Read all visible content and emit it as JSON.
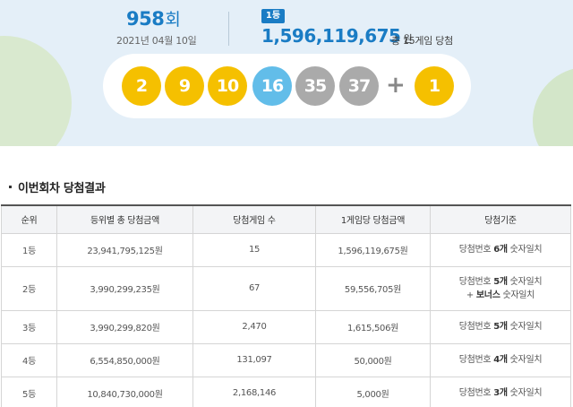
{
  "draw": {
    "round_number": "958",
    "round_unit": "회",
    "date": "2021년 04월 10일",
    "rank_badge": "1등",
    "first_prize": "1,596,119,675",
    "won": "원",
    "winner_summary": "총 15게임 당첨"
  },
  "balls": [
    {
      "number": "2",
      "color": "#f5c000"
    },
    {
      "number": "9",
      "color": "#f5c000"
    },
    {
      "number": "10",
      "color": "#f5c000"
    },
    {
      "number": "16",
      "color": "#62bde9"
    },
    {
      "number": "35",
      "color": "#aaaaaa"
    },
    {
      "number": "37",
      "color": "#aaaaaa"
    }
  ],
  "plus_sign": "+",
  "bonus_ball": {
    "number": "1",
    "color": "#f5c000"
  },
  "section_title": "이번회차 당첨결과",
  "table": {
    "headers": [
      "순위",
      "등위별 총 당첨금액",
      "당첨게임 수",
      "1게임당 당첨금액",
      "당첨기준"
    ],
    "rows": [
      {
        "rank": "1등",
        "total": "23,941,795,125원",
        "games": "15",
        "per_game": "1,596,119,675원",
        "crit_pre": "당첨번호 ",
        "crit_count": "6개",
        "crit_post": " 숫자일치",
        "bonus_pre": "",
        "bonus_bold": "",
        "bonus_post": ""
      },
      {
        "rank": "2등",
        "total": "3,990,299,235원",
        "games": "67",
        "per_game": "59,556,705원",
        "crit_pre": "당첨번호 ",
        "crit_count": "5개",
        "crit_post": " 숫자일치",
        "bonus_pre": "+ ",
        "bonus_bold": "보너스",
        "bonus_post": " 숫자일치"
      },
      {
        "rank": "3등",
        "total": "3,990,299,820원",
        "games": "2,470",
        "per_game": "1,615,506원",
        "crit_pre": "당첨번호 ",
        "crit_count": "5개",
        "crit_post": " 숫자일치",
        "bonus_pre": "",
        "bonus_bold": "",
        "bonus_post": ""
      },
      {
        "rank": "4등",
        "total": "6,554,850,000원",
        "games": "131,097",
        "per_game": "50,000원",
        "crit_pre": "당첨번호 ",
        "crit_count": "4개",
        "crit_post": " 숫자일치",
        "bonus_pre": "",
        "bonus_bold": "",
        "bonus_post": ""
      },
      {
        "rank": "5등",
        "total": "10,840,730,000원",
        "games": "2,168,146",
        "per_game": "5,000원",
        "crit_pre": "당첨번호 ",
        "crit_count": "3개",
        "crit_post": " 숫자일치",
        "bonus_pre": "",
        "bonus_bold": "",
        "bonus_post": ""
      }
    ]
  }
}
